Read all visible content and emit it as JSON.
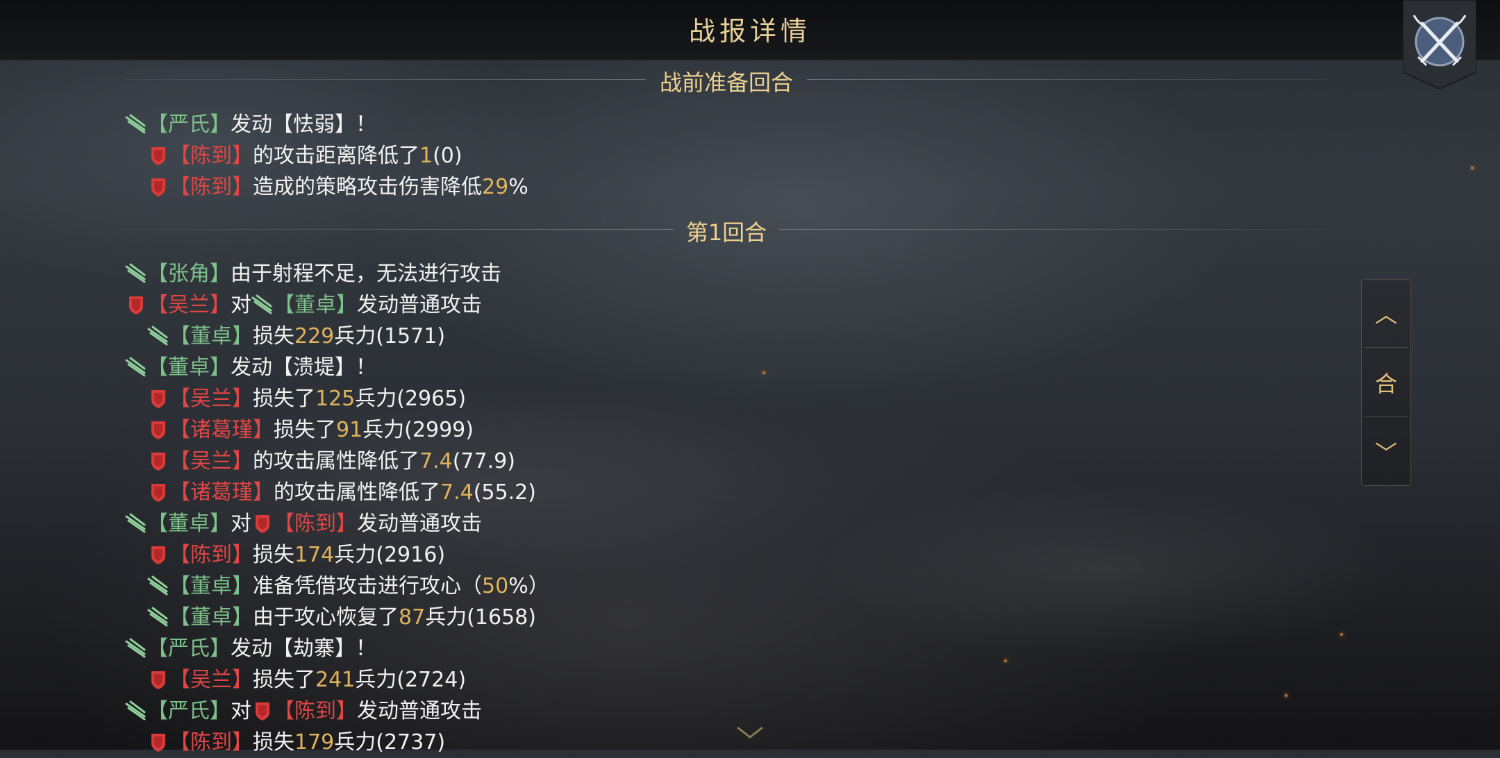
{
  "header": {
    "title": "战报详情",
    "close_icon": "crossed-swords-icon"
  },
  "colors": {
    "ally": "#7cc08a",
    "enemy": "#e04646",
    "number": "#e0b45c",
    "heading": "#ecd08e"
  },
  "sections": [
    {
      "label": "战前准备回合"
    },
    {
      "label": "第1回合"
    }
  ],
  "nav": {
    "up_label": "︿",
    "round_label": "合",
    "down_label": "﹀"
  },
  "log": [
    {
      "side": "ally",
      "indent": false,
      "parts": [
        [
          "a",
          "【严氏】"
        ],
        [
          "w",
          "发动【怯弱】！"
        ]
      ]
    },
    {
      "side": "enemy",
      "indent": true,
      "parts": [
        [
          "e",
          "【陈到】"
        ],
        [
          "w",
          "的攻击距离降低了"
        ],
        [
          "n",
          "1"
        ],
        [
          "w",
          "(0)"
        ]
      ]
    },
    {
      "side": "enemy",
      "indent": true,
      "parts": [
        [
          "e",
          "【陈到】"
        ],
        [
          "w",
          "造成的策略攻击伤害降低"
        ],
        [
          "n",
          "29"
        ],
        [
          "w",
          "%"
        ]
      ]
    },
    {
      "side": "ally",
      "indent": false,
      "parts": [
        [
          "a",
          "【张角】"
        ],
        [
          "w",
          "由于射程不足，无法进行攻击"
        ]
      ]
    },
    {
      "side": "enemy",
      "indent": false,
      "parts": [
        [
          "e",
          "【吴兰】"
        ],
        [
          "w",
          "对"
        ],
        [
          "ia",
          ""
        ],
        [
          "a",
          "【董卓】"
        ],
        [
          "w",
          "发动普通攻击"
        ]
      ]
    },
    {
      "side": "ally",
      "indent": true,
      "parts": [
        [
          "a",
          "【董卓】"
        ],
        [
          "w",
          "损失"
        ],
        [
          "n",
          "229"
        ],
        [
          "w",
          "兵力(1571)"
        ]
      ]
    },
    {
      "side": "ally",
      "indent": false,
      "parts": [
        [
          "a",
          "【董卓】"
        ],
        [
          "w",
          "发动【溃堤】！"
        ]
      ]
    },
    {
      "side": "enemy",
      "indent": true,
      "parts": [
        [
          "e",
          "【吴兰】"
        ],
        [
          "w",
          "损失了"
        ],
        [
          "n",
          "125"
        ],
        [
          "w",
          "兵力(2965)"
        ]
      ]
    },
    {
      "side": "enemy",
      "indent": true,
      "parts": [
        [
          "e",
          "【诸葛瑾】"
        ],
        [
          "w",
          "损失了"
        ],
        [
          "n",
          "91"
        ],
        [
          "w",
          "兵力(2999)"
        ]
      ]
    },
    {
      "side": "enemy",
      "indent": true,
      "parts": [
        [
          "e",
          "【吴兰】"
        ],
        [
          "w",
          "的攻击属性降低了"
        ],
        [
          "n",
          "7.4"
        ],
        [
          "w",
          "(77.9)"
        ]
      ]
    },
    {
      "side": "enemy",
      "indent": true,
      "parts": [
        [
          "e",
          "【诸葛瑾】"
        ],
        [
          "w",
          "的攻击属性降低了"
        ],
        [
          "n",
          "7.4"
        ],
        [
          "w",
          "(55.2)"
        ]
      ]
    },
    {
      "side": "ally",
      "indent": false,
      "parts": [
        [
          "a",
          "【董卓】"
        ],
        [
          "w",
          "对"
        ],
        [
          "ie",
          ""
        ],
        [
          "e",
          "【陈到】"
        ],
        [
          "w",
          "发动普通攻击"
        ]
      ]
    },
    {
      "side": "enemy",
      "indent": true,
      "parts": [
        [
          "e",
          "【陈到】"
        ],
        [
          "w",
          "损失"
        ],
        [
          "n",
          "174"
        ],
        [
          "w",
          "兵力(2916)"
        ]
      ]
    },
    {
      "side": "ally",
      "indent": true,
      "parts": [
        [
          "a",
          "【董卓】"
        ],
        [
          "w",
          "准备凭借攻击进行攻心（"
        ],
        [
          "n",
          "50"
        ],
        [
          "w",
          "%）"
        ]
      ]
    },
    {
      "side": "ally",
      "indent": true,
      "parts": [
        [
          "a",
          "【董卓】"
        ],
        [
          "w",
          "由于攻心恢复了"
        ],
        [
          "n",
          "87"
        ],
        [
          "w",
          "兵力(1658)"
        ]
      ]
    },
    {
      "side": "ally",
      "indent": false,
      "parts": [
        [
          "a",
          "【严氏】"
        ],
        [
          "w",
          "发动【劫寨】！"
        ]
      ]
    },
    {
      "side": "enemy",
      "indent": true,
      "parts": [
        [
          "e",
          "【吴兰】"
        ],
        [
          "w",
          "损失了"
        ],
        [
          "n",
          "241"
        ],
        [
          "w",
          "兵力(2724)"
        ]
      ]
    },
    {
      "side": "ally",
      "indent": false,
      "parts": [
        [
          "a",
          "【严氏】"
        ],
        [
          "w",
          "对"
        ],
        [
          "ie",
          ""
        ],
        [
          "e",
          "【陈到】"
        ],
        [
          "w",
          "发动普通攻击"
        ]
      ]
    },
    {
      "side": "enemy",
      "indent": true,
      "parts": [
        [
          "e",
          "【陈到】"
        ],
        [
          "w",
          "损失"
        ],
        [
          "n",
          "179"
        ],
        [
          "w",
          "兵力(2737)"
        ]
      ]
    }
  ]
}
